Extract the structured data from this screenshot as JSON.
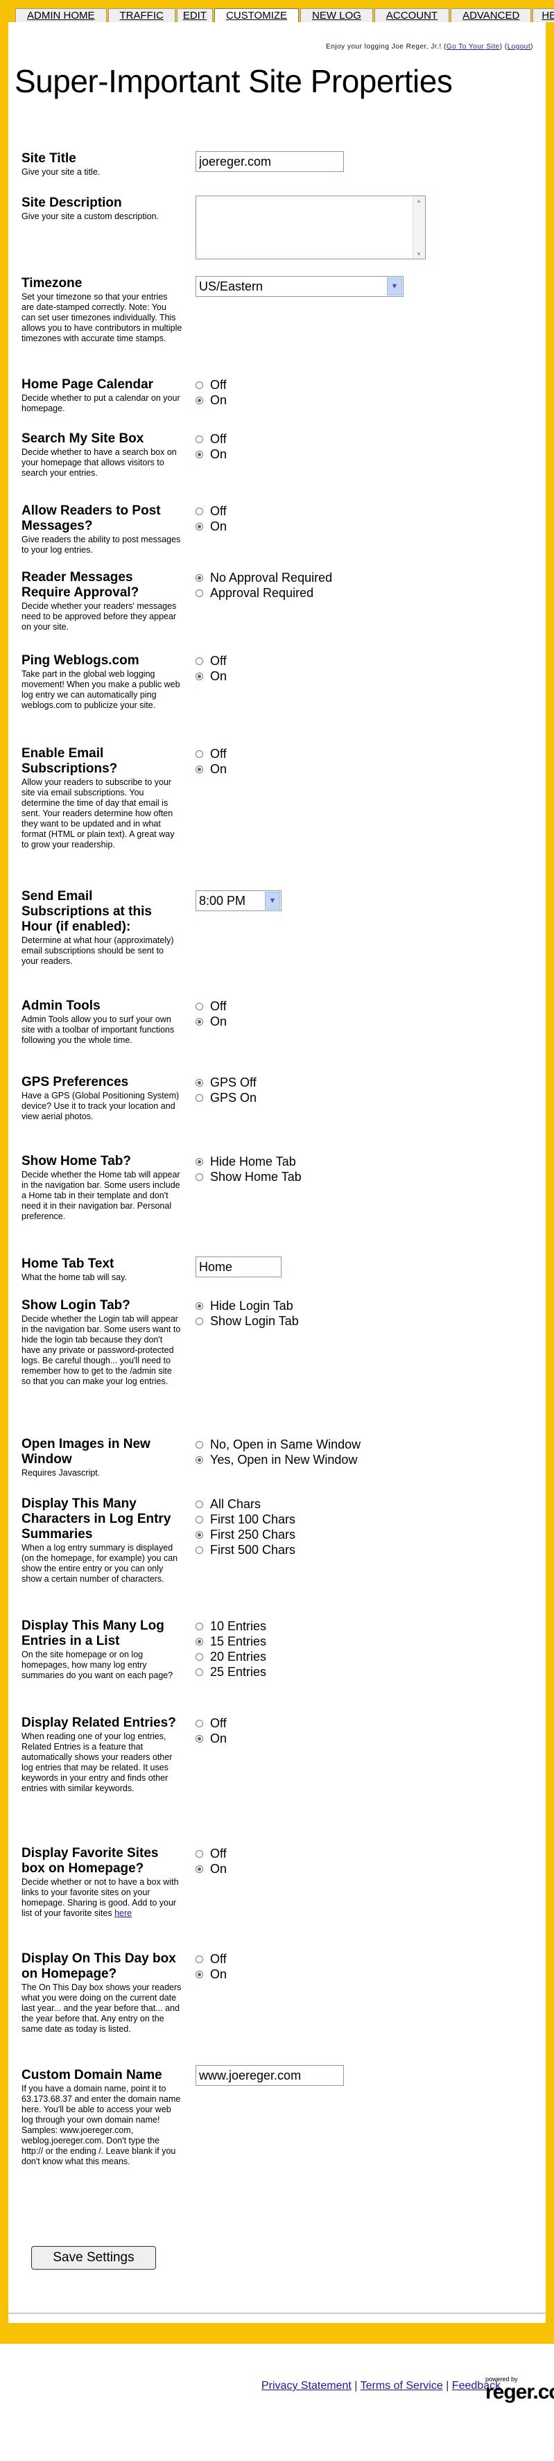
{
  "nav": {
    "tabs": [
      {
        "label": "ADMIN HOME"
      },
      {
        "label": "TRAFFIC"
      },
      {
        "label": "EDIT"
      },
      {
        "label": "CUSTOMIZE"
      },
      {
        "label": "NEW LOG"
      },
      {
        "label": "ACCOUNT"
      },
      {
        "label": "ADVANCED"
      },
      {
        "label": "HELP"
      }
    ],
    "active": "CUSTOMIZE"
  },
  "tagline": {
    "text": "Enjoy your logging Joe Reger, Jr.!",
    "goto_label": "Go To Your Site",
    "logout_label": "Logout"
  },
  "page_title": "Super-Important Site Properties",
  "fields": {
    "site_title": {
      "label": "Site Title",
      "desc": "Give your site a title.",
      "value": "joereger.com"
    },
    "site_description": {
      "label": "Site Description",
      "desc": "Give your site a custom description.",
      "value": ""
    },
    "timezone": {
      "label": "Timezone",
      "desc": "Set your timezone so that your entries are date-stamped correctly. Note: You can set user timezones individually. This allows you to have contributors in multiple timezones with accurate time stamps.",
      "value": "US/Eastern"
    },
    "home_calendar": {
      "label": "Home Page Calendar",
      "desc": "Decide whether to put a calendar on your homepage.",
      "options": [
        "Off",
        "On"
      ]
    },
    "search_box": {
      "label": "Search My Site Box",
      "desc": "Decide whether to have a search box on your homepage that allows visitors to search your entries.",
      "options": [
        "Off",
        "On"
      ]
    },
    "allow_post": {
      "label": "Allow Readers to Post Messages?",
      "desc": "Give readers the ability to post messages to your log entries.",
      "options": [
        "Off",
        "On"
      ]
    },
    "approval": {
      "label": "Reader Messages Require Approval?",
      "desc": "Decide whether your readers' messages need to be approved before they appear on your site.",
      "options": [
        "No Approval Required",
        "Approval Required"
      ]
    },
    "ping": {
      "label": "Ping Weblogs.com",
      "desc": "Take part in the global web logging movement! When you make a public web log entry we can automatically ping weblogs.com to publicize your site.",
      "options": [
        "Off",
        "On"
      ]
    },
    "email_subs": {
      "label": "Enable Email Subscriptions?",
      "desc": "Allow your readers to subscribe to your site via email subscriptions. You determine the time of day that email is sent. Your readers determine how often they want to be updated and in what format (HTML or plain text). A great way to grow your readership.",
      "options": [
        "Off",
        "On"
      ]
    },
    "send_hour": {
      "label": "Send Email Subscriptions at this Hour (if enabled):",
      "desc": "Determine at what hour (approximately) email subscriptions should be sent to your readers.",
      "value": "8:00 PM"
    },
    "admin_tools": {
      "label": "Admin Tools",
      "desc": "Admin Tools allow you to surf your own site with a toolbar of important functions following you the whole time.",
      "options": [
        "Off",
        "On"
      ]
    },
    "gps": {
      "label": "GPS Preferences",
      "desc": "Have a GPS (Global Positioning System) device? Use it to track your location and view aerial photos.",
      "options": [
        "GPS Off",
        "GPS On"
      ]
    },
    "home_tab": {
      "label": "Show Home Tab?",
      "desc": "Decide whether the Home tab will appear in the navigation bar. Some users include a Home tab in their template and don't need it in their navigation bar. Personal preference.",
      "options": [
        "Hide Home Tab",
        "Show Home Tab"
      ]
    },
    "home_tab_text": {
      "label": "Home Tab Text",
      "desc": "What the home tab will say.",
      "value": "Home"
    },
    "login_tab": {
      "label": "Show Login Tab?",
      "desc": "Decide whether the Login tab will appear in the navigation bar. Some users want to hide the login tab because they don't have any private or password-protected logs. Be careful though... you'll need to remember how to get to the /admin site so that you can make your log entries.",
      "options": [
        "Hide Login Tab",
        "Show Login Tab"
      ]
    },
    "open_images": {
      "label": "Open Images in New Window",
      "desc": "Requires Javascript.",
      "options": [
        "No, Open in Same Window",
        "Yes, Open in New Window"
      ]
    },
    "summary_chars": {
      "label": "Display This Many Characters in Log Entry Summaries",
      "desc": "When a log entry summary is displayed (on the homepage, for example) you can show the entire entry or you can only show a certain number of characters.",
      "options": [
        "All Chars",
        "First 100 Chars",
        "First 250 Chars",
        "First 500 Chars"
      ]
    },
    "list_entries": {
      "label": "Display This Many Log Entries in a List",
      "desc": "On the site homepage or on log homepages, how many log entry summaries do you want on each page?",
      "options": [
        "10 Entries",
        "15 Entries",
        "20 Entries",
        "25 Entries"
      ]
    },
    "related": {
      "label": "Display Related Entries?",
      "desc": "When reading one of your log entries, Related Entries is a feature that automatically shows your readers other log entries that may be related. It uses keywords in your entry and finds other entries with similar keywords.",
      "options": [
        "Off",
        "On"
      ]
    },
    "favorites": {
      "label": "Display Favorite Sites box on Homepage?",
      "desc": "Decide whether or not to have a box with links to your favorite sites on your homepage. Sharing is good. Add to your list of your favorite sites",
      "link": "here",
      "options": [
        "Off",
        "On"
      ]
    },
    "on_this_day": {
      "label": "Display On This Day box on Homepage?",
      "desc": "The On This Day box shows your readers what you were doing on the current date last year... and the year before that... and the year before that. Any entry on the same date as today is listed.",
      "options": [
        "Off",
        "On"
      ]
    },
    "domain": {
      "label": "Custom Domain Name",
      "desc": "If you have a domain name, point it to 63.173.68.37 and enter the domain name here. You'll be able to access your web log through your own domain name! Samples: www.joereger.com, weblog.joereger.com. Don't type the http:// or the ending /. Leave blank if you don't know what this means.",
      "value": "www.joereger.com"
    }
  },
  "save_label": "Save Settings",
  "footer": {
    "links": [
      "Privacy Statement",
      "Terms of Service",
      "Feedback"
    ],
    "separator": "|",
    "powered_by": "powered by",
    "brand": "reger.com"
  }
}
